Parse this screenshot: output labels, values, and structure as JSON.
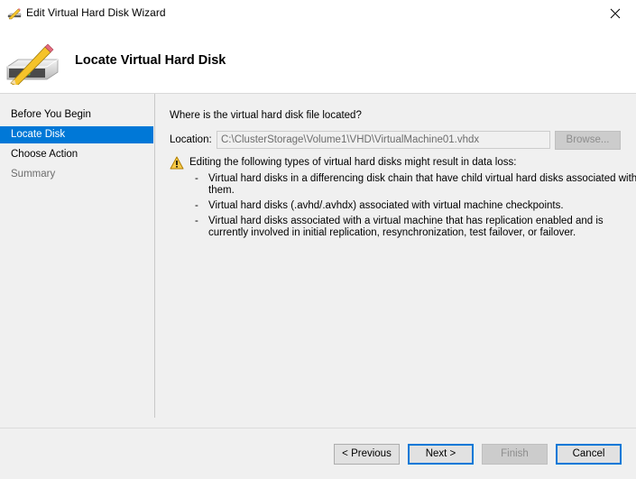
{
  "window": {
    "title": "Edit Virtual Hard Disk Wizard",
    "close_icon": "close-icon"
  },
  "header": {
    "title": "Locate Virtual Hard Disk",
    "icon": "hard-disk-pencil-icon"
  },
  "sidebar": {
    "items": [
      {
        "label": "Before You Begin",
        "state": "normal"
      },
      {
        "label": "Locate Disk",
        "state": "active"
      },
      {
        "label": "Choose Action",
        "state": "normal"
      },
      {
        "label": "Summary",
        "state": "disabled"
      }
    ]
  },
  "main": {
    "question": "Where is the virtual hard disk file located?",
    "location_label": "Location:",
    "location_value": "C:\\ClusterStorage\\Volume1\\VHD\\VirtualMachine01.vhdx",
    "browse_label": "Browse...",
    "warning": {
      "icon": "warning-icon",
      "title": "Editing the following types of virtual hard disks might result in data loss:",
      "items": [
        "Virtual hard disks in a differencing disk chain that have child virtual hard disks associated with them.",
        "Virtual hard disks (.avhd/.avhdx) associated with virtual machine checkpoints.",
        "Virtual hard disks associated with a virtual machine that has replication enabled and is currently involved in initial replication, resynchronization, test failover, or failover."
      ]
    }
  },
  "footer": {
    "previous_label": "< Previous",
    "next_label": "Next >",
    "finish_label": "Finish",
    "cancel_label": "Cancel"
  },
  "colors": {
    "accent": "#0078d7",
    "background": "#f0f0f0",
    "header_background": "#ffffff"
  }
}
